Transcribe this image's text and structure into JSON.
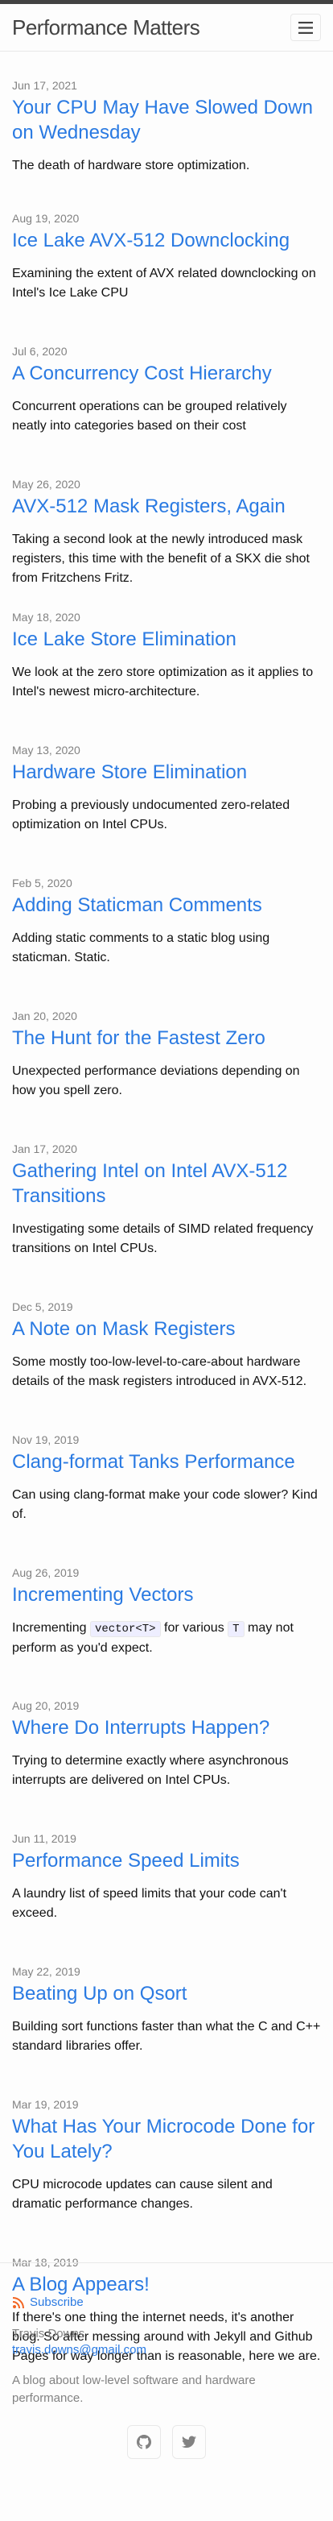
{
  "site": {
    "title": "Performance Matters"
  },
  "posts": [
    {
      "date": "Jun 17, 2021",
      "title": "Your CPU May Have Slowed Down on Wednesday",
      "excerpt": "The death of hardware store optimization."
    },
    {
      "date": "Aug 19, 2020",
      "title": "Ice Lake AVX-512 Downclocking",
      "excerpt": "Examining the extent of AVX related downclocking on Intel's Ice Lake CPU"
    },
    {
      "date": "Jul 6, 2020",
      "title": "A Concurrency Cost Hierarchy",
      "excerpt": "Concurrent operations can be grouped relatively neatly into categories based on their cost"
    },
    {
      "date": "May 26, 2020",
      "title": "AVX-512 Mask Registers, Again",
      "excerpt": "Taking a second look at the newly introduced mask registers, this time with the benefit of a SKX die shot from Fritzchens Fritz."
    },
    {
      "date": "May 18, 2020",
      "title": "Ice Lake Store Elimination",
      "excerpt": "We look at the zero store optimization as it applies to Intel's newest micro-architecture."
    },
    {
      "date": "May 13, 2020",
      "title": "Hardware Store Elimination",
      "excerpt": "Probing a previously undocumented zero-related optimization on Intel CPUs."
    },
    {
      "date": "Feb 5, 2020",
      "title": "Adding Staticman Comments",
      "excerpt": "Adding static comments to a static blog using staticman. Static."
    },
    {
      "date": "Jan 20, 2020",
      "title": "The Hunt for the Fastest Zero",
      "excerpt": "Unexpected performance deviations depending on how you spell zero."
    },
    {
      "date": "Jan 17, 2020",
      "title": "Gathering Intel on Intel AVX-512 Transitions",
      "excerpt": "Investigating some details of SIMD related frequency transitions on Intel CPUs."
    },
    {
      "date": "Dec 5, 2019",
      "title": "A Note on Mask Registers",
      "excerpt": "Some mostly too-low-level-to-care-about hardware details of the mask registers introduced in AVX-512."
    },
    {
      "date": "Nov 19, 2019",
      "title": "Clang-format Tanks Performance",
      "excerpt": "Can using clang-format make your code slower? Kind of."
    },
    {
      "date": "Aug 26, 2019",
      "title": "Incrementing Vectors",
      "excerpt_pre": "Incrementing ",
      "excerpt_code1": "vector<T>",
      "excerpt_mid": " for various ",
      "excerpt_code2": "T",
      "excerpt_post": " may not perform as you'd expect."
    },
    {
      "date": "Aug 20, 2019",
      "title": "Where Do Interrupts Happen?",
      "excerpt": "Trying to determine exactly where asynchronous interrupts are delivered on Intel CPUs."
    },
    {
      "date": "Jun 11, 2019",
      "title": "Performance Speed Limits",
      "excerpt": "A laundry list of speed limits that your code can't exceed."
    },
    {
      "date": "May 22, 2019",
      "title": "Beating Up on Qsort",
      "excerpt": "Building sort functions faster than what the C and C++ standard libraries offer."
    },
    {
      "date": "Mar 19, 2019",
      "title": "What Has Your Microcode Done for You Lately?",
      "excerpt": "CPU microcode updates can cause silent and dramatic performance changes."
    },
    {
      "date": "Mar 18, 2019",
      "title": "A Blog Appears!",
      "excerpt": "If there's one thing the internet needs, it's another blog. So after messing around with Jekyll and Github Pages for way longer than is reasonable, here we are."
    }
  ],
  "footer": {
    "subscribe_label": "Subscribe",
    "author": "Travis Downs",
    "email": "travis.downs@gmail.com",
    "description": "A blog about low-level software and hardware performance."
  },
  "colors": {
    "link": "#2a7ae2",
    "meta": "#828282",
    "topbar": "#424242"
  }
}
